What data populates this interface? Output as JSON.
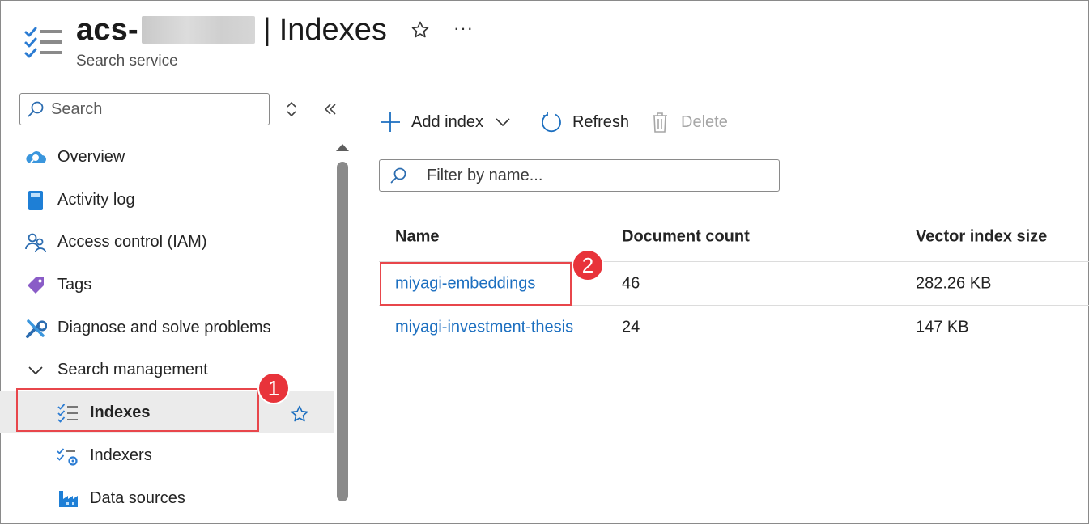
{
  "header": {
    "resource_prefix": "acs-",
    "separator": "|",
    "page_title": "Indexes",
    "subtitle": "Search service",
    "favorite_icon": "star-outline-icon",
    "more_label": "···"
  },
  "sidebar": {
    "search_placeholder": "Search",
    "items": [
      {
        "label": "Overview",
        "icon": "cloud-search-icon"
      },
      {
        "label": "Activity log",
        "icon": "log-book-icon"
      },
      {
        "label": "Access control (IAM)",
        "icon": "people-icon"
      },
      {
        "label": "Tags",
        "icon": "tag-icon"
      },
      {
        "label": "Diagnose and solve problems",
        "icon": "wrench-icon"
      }
    ],
    "group": {
      "label": "Search management",
      "expanded": true
    },
    "subitems": [
      {
        "label": "Indexes",
        "icon": "list-check-icon",
        "selected": true
      },
      {
        "label": "Indexers",
        "icon": "indexer-gear-icon"
      },
      {
        "label": "Data sources",
        "icon": "factory-icon"
      }
    ]
  },
  "toolbar": {
    "add_index": "Add index",
    "refresh": "Refresh",
    "delete": "Delete"
  },
  "filter": {
    "placeholder": "Filter by name..."
  },
  "table": {
    "headers": [
      "Name",
      "Document count",
      "Vector index size"
    ],
    "rows": [
      {
        "name": "miyagi-embeddings",
        "count": "46",
        "size": "282.26 KB"
      },
      {
        "name": "miyagi-investment-thesis",
        "count": "24",
        "size": "147 KB"
      }
    ]
  },
  "annotations": {
    "step1": "1",
    "step2": "2"
  },
  "colors": {
    "accent": "#0f6cbd",
    "link": "#1c6fc0",
    "highlight": "#e8464b",
    "badge": "#e8333a"
  }
}
